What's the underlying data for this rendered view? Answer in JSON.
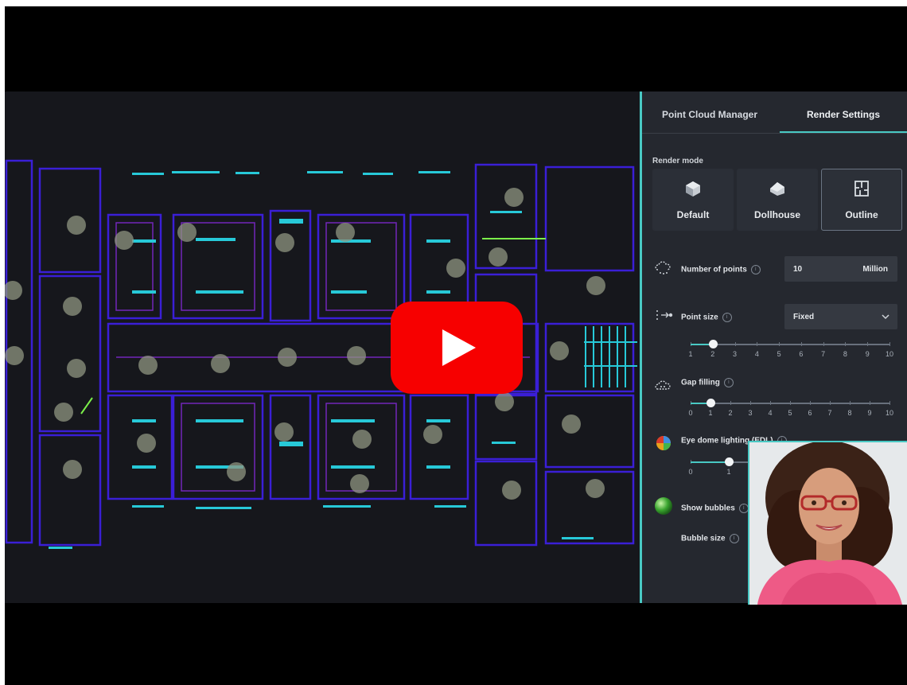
{
  "tabs": [
    {
      "label": "Point Cloud Manager",
      "active": false
    },
    {
      "label": "Render Settings",
      "active": true
    }
  ],
  "render_mode": {
    "label": "Render mode",
    "options": [
      {
        "label": "Default",
        "icon": "cube-icon",
        "active": false
      },
      {
        "label": "Dollhouse",
        "icon": "house-icon",
        "active": false
      },
      {
        "label": "Outline",
        "icon": "floorplan-icon",
        "active": true
      }
    ]
  },
  "number_of_points": {
    "label": "Number of points",
    "value": "10",
    "unit": "Million"
  },
  "point_size": {
    "label": "Point size",
    "select_value": "Fixed",
    "slider_value": 2,
    "ticks": [
      "1",
      "2",
      "3",
      "4",
      "5",
      "6",
      "7",
      "8",
      "9",
      "10"
    ]
  },
  "gap_filling": {
    "label": "Gap filling",
    "slider_value": 1,
    "ticks": [
      "0",
      "1",
      "2",
      "3",
      "4",
      "5",
      "6",
      "7",
      "8",
      "9",
      "10"
    ]
  },
  "edl": {
    "label": "Eye dome lighting (EDL)",
    "slider_value": 1,
    "ticks": [
      "0",
      "1"
    ]
  },
  "show_bubbles": {
    "label": "Show bubbles"
  },
  "bubble_size": {
    "label": "Bubble size"
  },
  "colors": {
    "accent": "#49c9c4",
    "youtube_red": "#f70000",
    "plan_wall": "#3a1fd6"
  },
  "icons": {
    "info": "i",
    "chevron": "chevron-down-icon",
    "play": "play-icon"
  }
}
